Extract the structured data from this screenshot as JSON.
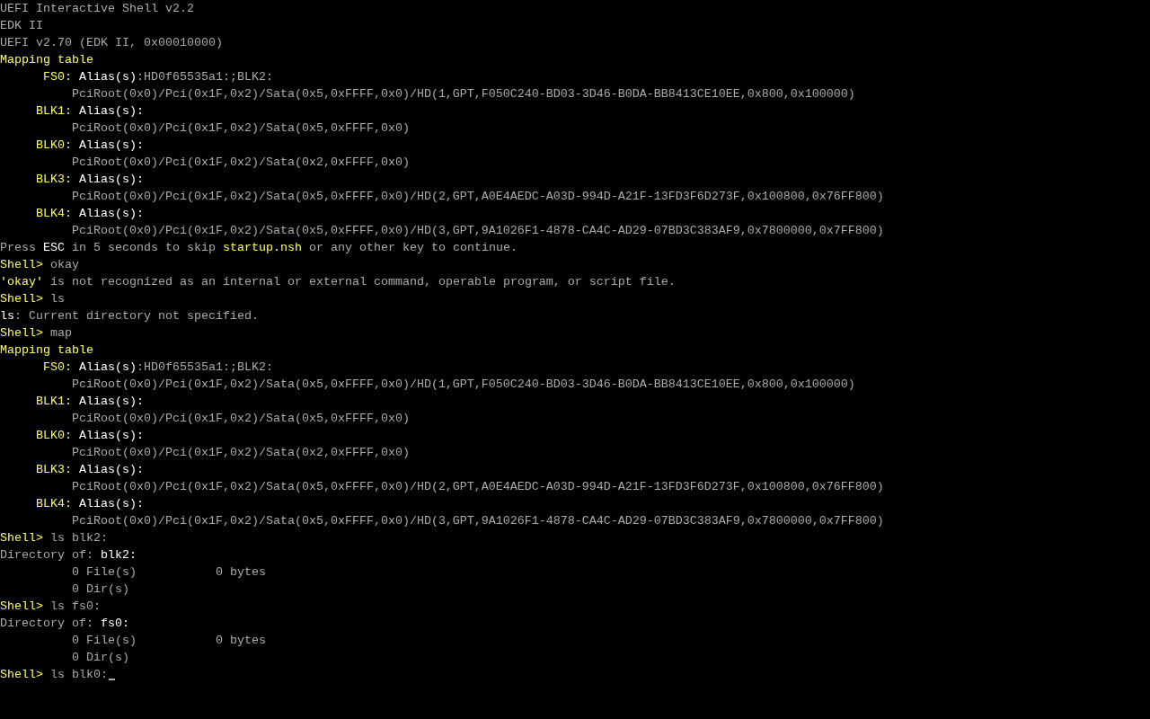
{
  "console": {
    "lines": [
      {
        "kind": "plain",
        "segments": [
          {
            "text": "UEFI Interactive Shell v2.2",
            "color": "#aaaaaa"
          }
        ]
      },
      {
        "kind": "plain",
        "segments": [
          {
            "text": "EDK II",
            "color": "#aaaaaa"
          }
        ]
      },
      {
        "kind": "plain",
        "segments": [
          {
            "text": "UEFI v2.70 (EDK II, 0x00010000)",
            "color": "#aaaaaa"
          }
        ]
      },
      {
        "kind": "plain",
        "segments": [
          {
            "text": "Mapping table",
            "color": "#ffff55"
          }
        ]
      },
      {
        "kind": "device",
        "device": "FS0:",
        "segments": [
          {
            "text": "Alias(s)",
            "color": "#ffffff"
          },
          {
            "text": ":HD0f65535a1:;BLK2:",
            "color": "#aaaaaa"
          }
        ]
      },
      {
        "kind": "path",
        "segments": [
          {
            "text": "PciRoot(0x0)/Pci(0x1F,0x2)/Sata(0x5,0xFFFF,0x0)/HD(1,GPT,F050C240-BD03-3D46-B0DA-BB8413CE10EE,0x800,0x100000)",
            "color": "#aaaaaa"
          }
        ]
      },
      {
        "kind": "device",
        "device": "BLK1:",
        "segments": [
          {
            "text": "Alias(s):",
            "color": "#ffffff"
          }
        ]
      },
      {
        "kind": "path",
        "segments": [
          {
            "text": "PciRoot(0x0)/Pci(0x1F,0x2)/Sata(0x5,0xFFFF,0x0)",
            "color": "#aaaaaa"
          }
        ]
      },
      {
        "kind": "device",
        "device": "BLK0:",
        "segments": [
          {
            "text": "Alias(s):",
            "color": "#ffffff"
          }
        ]
      },
      {
        "kind": "path",
        "segments": [
          {
            "text": "PciRoot(0x0)/Pci(0x1F,0x2)/Sata(0x2,0xFFFF,0x0)",
            "color": "#aaaaaa"
          }
        ]
      },
      {
        "kind": "device",
        "device": "BLK3:",
        "segments": [
          {
            "text": "Alias(s):",
            "color": "#ffffff"
          }
        ]
      },
      {
        "kind": "path",
        "segments": [
          {
            "text": "PciRoot(0x0)/Pci(0x1F,0x2)/Sata(0x5,0xFFFF,0x0)/HD(2,GPT,A0E4AEDC-A03D-994D-A21F-13FD3F6D273F,0x100800,0x76FF800)",
            "color": "#aaaaaa"
          }
        ]
      },
      {
        "kind": "device",
        "device": "BLK4:",
        "segments": [
          {
            "text": "Alias(s):",
            "color": "#ffffff"
          }
        ]
      },
      {
        "kind": "path",
        "segments": [
          {
            "text": "PciRoot(0x0)/Pci(0x1F,0x2)/Sata(0x5,0xFFFF,0x0)/HD(3,GPT,9A1026F1-4878-CA4C-AD29-07BD3C383AF9,0x7800000,0x7FF800)",
            "color": "#aaaaaa"
          }
        ]
      },
      {
        "kind": "plain",
        "segments": [
          {
            "text": "Press ",
            "color": "#aaaaaa"
          },
          {
            "text": "ESC",
            "color": "#ffffff"
          },
          {
            "text": " in 5 seconds to skip ",
            "color": "#aaaaaa"
          },
          {
            "text": "startup.nsh",
            "color": "#ffff55"
          },
          {
            "text": " or any other key to continue.",
            "color": "#aaaaaa"
          }
        ]
      },
      {
        "kind": "prompt",
        "segments": [
          {
            "text": "Shell>",
            "color": "#ffff55"
          },
          {
            "text": " okay",
            "color": "#aaaaaa"
          }
        ]
      },
      {
        "kind": "plain",
        "segments": [
          {
            "text": "'okay'",
            "color": "#ffff55"
          },
          {
            "text": " is not recognized as an internal or external command, operable program, or script file.",
            "color": "#aaaaaa"
          }
        ]
      },
      {
        "kind": "prompt",
        "segments": [
          {
            "text": "Shell>",
            "color": "#ffff55"
          },
          {
            "text": " ls",
            "color": "#aaaaaa"
          }
        ]
      },
      {
        "kind": "plain",
        "segments": [
          {
            "text": "ls",
            "color": "#ffffff"
          },
          {
            "text": ": Current directory not specified.",
            "color": "#aaaaaa"
          }
        ]
      },
      {
        "kind": "prompt",
        "segments": [
          {
            "text": "Shell>",
            "color": "#ffff55"
          },
          {
            "text": " map",
            "color": "#aaaaaa"
          }
        ]
      },
      {
        "kind": "plain",
        "segments": [
          {
            "text": "Mapping table",
            "color": "#ffff55"
          }
        ]
      },
      {
        "kind": "device",
        "device": "FS0:",
        "segments": [
          {
            "text": "Alias(s)",
            "color": "#ffffff"
          },
          {
            "text": ":HD0f65535a1:;BLK2:",
            "color": "#aaaaaa"
          }
        ]
      },
      {
        "kind": "path",
        "segments": [
          {
            "text": "PciRoot(0x0)/Pci(0x1F,0x2)/Sata(0x5,0xFFFF,0x0)/HD(1,GPT,F050C240-BD03-3D46-B0DA-BB8413CE10EE,0x800,0x100000)",
            "color": "#aaaaaa"
          }
        ]
      },
      {
        "kind": "device",
        "device": "BLK1:",
        "segments": [
          {
            "text": "Alias(s):",
            "color": "#ffffff"
          }
        ]
      },
      {
        "kind": "path",
        "segments": [
          {
            "text": "PciRoot(0x0)/Pci(0x1F,0x2)/Sata(0x5,0xFFFF,0x0)",
            "color": "#aaaaaa"
          }
        ]
      },
      {
        "kind": "device",
        "device": "BLK0:",
        "segments": [
          {
            "text": "Alias(s):",
            "color": "#ffffff"
          }
        ]
      },
      {
        "kind": "path",
        "segments": [
          {
            "text": "PciRoot(0x0)/Pci(0x1F,0x2)/Sata(0x2,0xFFFF,0x0)",
            "color": "#aaaaaa"
          }
        ]
      },
      {
        "kind": "device",
        "device": "BLK3:",
        "segments": [
          {
            "text": "Alias(s):",
            "color": "#ffffff"
          }
        ]
      },
      {
        "kind": "path",
        "segments": [
          {
            "text": "PciRoot(0x0)/Pci(0x1F,0x2)/Sata(0x5,0xFFFF,0x0)/HD(2,GPT,A0E4AEDC-A03D-994D-A21F-13FD3F6D273F,0x100800,0x76FF800)",
            "color": "#aaaaaa"
          }
        ]
      },
      {
        "kind": "device",
        "device": "BLK4:",
        "segments": [
          {
            "text": "Alias(s):",
            "color": "#ffffff"
          }
        ]
      },
      {
        "kind": "path",
        "segments": [
          {
            "text": "PciRoot(0x0)/Pci(0x1F,0x2)/Sata(0x5,0xFFFF,0x0)/HD(3,GPT,9A1026F1-4878-CA4C-AD29-07BD3C383AF9,0x7800000,0x7FF800)",
            "color": "#aaaaaa"
          }
        ]
      },
      {
        "kind": "prompt",
        "segments": [
          {
            "text": "Shell>",
            "color": "#ffff55"
          },
          {
            "text": " ls blk2:",
            "color": "#aaaaaa"
          }
        ]
      },
      {
        "kind": "plain",
        "segments": [
          {
            "text": "Directory of: ",
            "color": "#aaaaaa"
          },
          {
            "text": "blk2:",
            "color": "#ffffff"
          }
        ]
      },
      {
        "kind": "path",
        "segments": [
          {
            "text": "0 File(s)           0 bytes",
            "color": "#aaaaaa"
          }
        ]
      },
      {
        "kind": "path",
        "segments": [
          {
            "text": "0 Dir(s)",
            "color": "#aaaaaa"
          }
        ]
      },
      {
        "kind": "prompt",
        "segments": [
          {
            "text": "Shell>",
            "color": "#ffff55"
          },
          {
            "text": " ls fs0:",
            "color": "#aaaaaa"
          }
        ]
      },
      {
        "kind": "plain",
        "segments": [
          {
            "text": "Directory of: ",
            "color": "#aaaaaa"
          },
          {
            "text": "fs0:",
            "color": "#ffffff"
          }
        ]
      },
      {
        "kind": "path",
        "segments": [
          {
            "text": "0 File(s)           0 bytes",
            "color": "#aaaaaa"
          }
        ]
      },
      {
        "kind": "path",
        "segments": [
          {
            "text": "0 Dir(s)",
            "color": "#aaaaaa"
          }
        ]
      },
      {
        "kind": "prompt",
        "cursor": true,
        "segments": [
          {
            "text": "Shell>",
            "color": "#ffff55"
          },
          {
            "text": " ls blk0:",
            "color": "#aaaaaa"
          }
        ]
      }
    ]
  }
}
